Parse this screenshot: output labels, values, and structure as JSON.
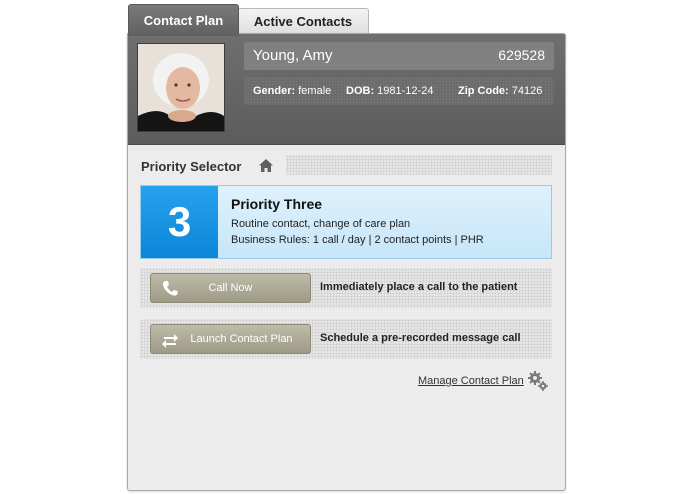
{
  "tabs": [
    {
      "label": "Contact Plan"
    },
    {
      "label": "Active Contacts"
    }
  ],
  "patient": {
    "name": "Young, Amy",
    "id": "629528",
    "gender_label": "Gender:",
    "gender": "female",
    "dob_label": "DOB:",
    "dob": "1981-12-24",
    "zip_label": "Zip Code:",
    "zip": "74126"
  },
  "priority_selector": {
    "title": "Priority Selector",
    "icon": "home-icon"
  },
  "priority": {
    "number": "3",
    "title": "Priority Three",
    "line1": "Routine contact, change of care plan",
    "line2": "Business Rules: 1 call / day | 2 contact points | PHR",
    "color": "#1a96e6"
  },
  "actions": [
    {
      "label": "Call Now",
      "icon": "phone-icon",
      "description": "Immediately place a call to the patient"
    },
    {
      "label": "Launch Contact Plan",
      "icon": "swap-arrows-icon",
      "description": "Schedule a pre-recorded message call"
    }
  ],
  "manage": {
    "label": "Manage Contact Plan",
    "icon": "gear-icon"
  }
}
